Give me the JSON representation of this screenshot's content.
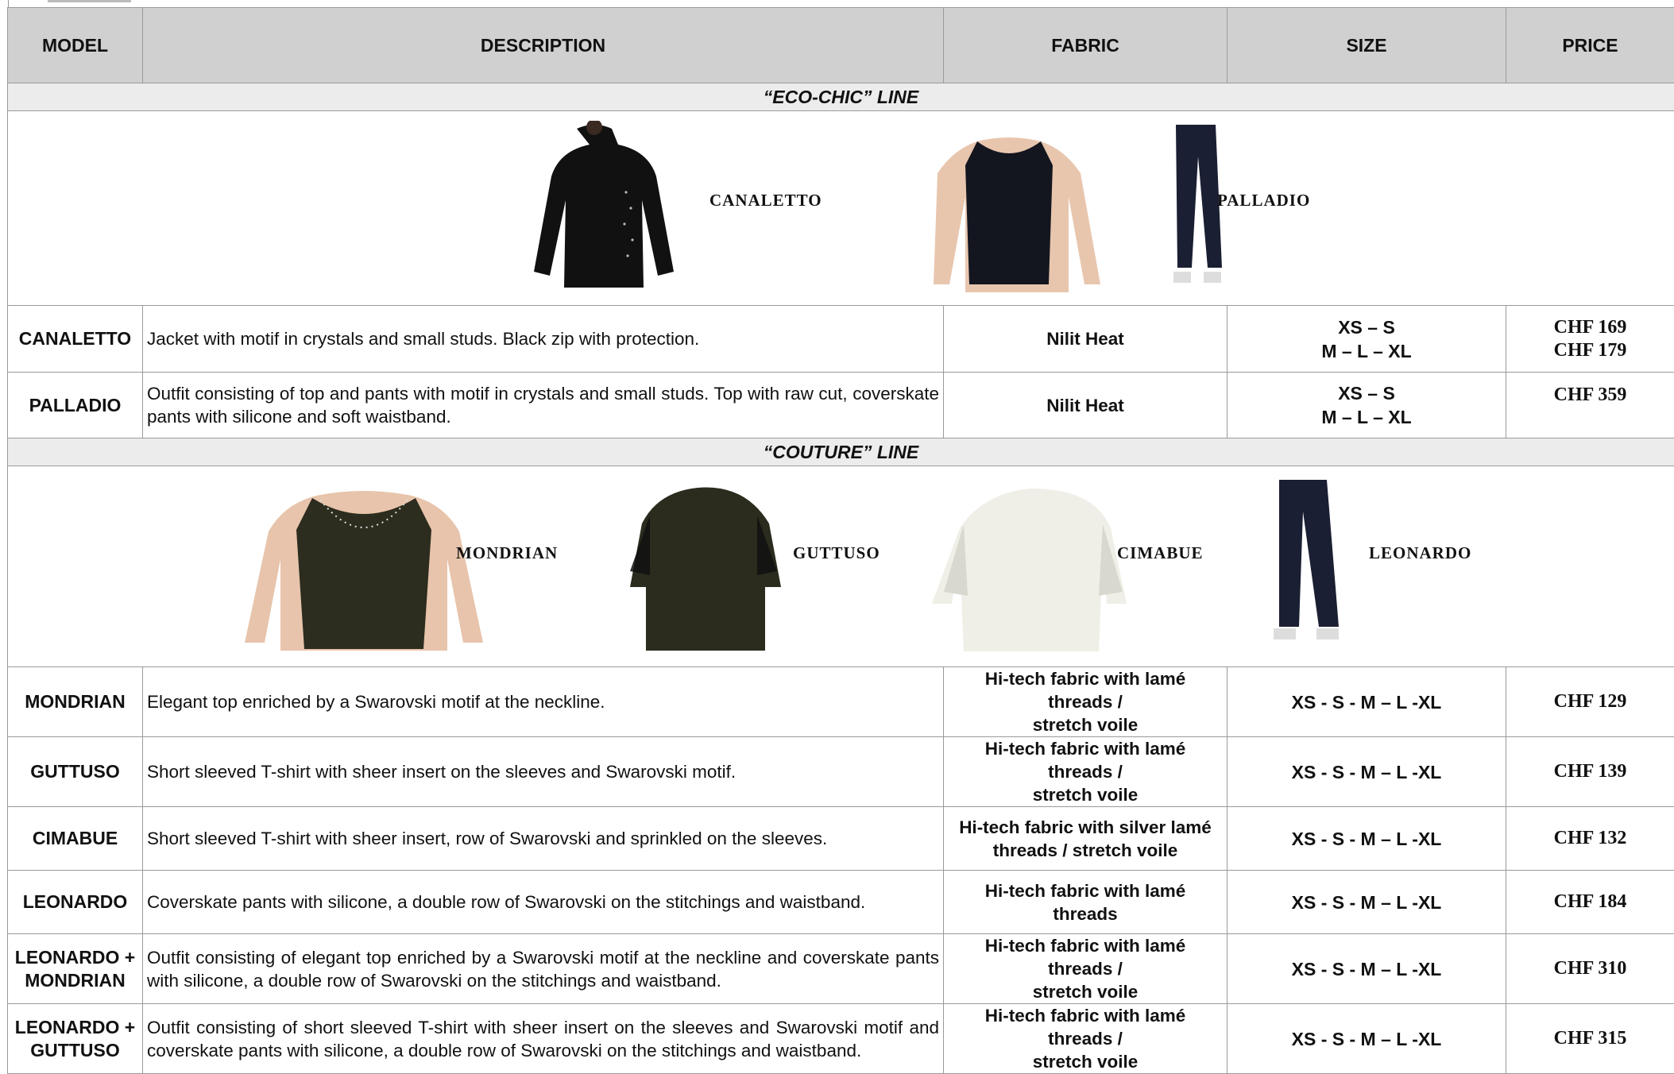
{
  "headers": {
    "model": "MODEL",
    "description": "DESCRIPTION",
    "fabric": "FABRIC",
    "size": "SIZE",
    "price": "PRICE"
  },
  "eco_chic": {
    "title": "“ECO-CHIC” LINE",
    "gallery": [
      "CANALETTO",
      "PALLADIO"
    ],
    "rows": [
      {
        "model": "CANALETTO",
        "description": "Jacket with motif in crystals and small studs. Black zip with protection.",
        "fabric": "Nilit Heat",
        "size_1": "XS – S",
        "size_2": "M – L – XL",
        "price_1": "CHF 169",
        "price_2": "CHF 179"
      },
      {
        "model": "PALLADIO",
        "description": "Outfit consisting of top and pants with motif in crystals and small studs. Top with raw cut, coverskate pants with silicone and soft waistband.",
        "fabric": "Nilit Heat",
        "size_1": "XS – S",
        "size_2": "M – L – XL",
        "price_1": "CHF 359"
      }
    ]
  },
  "couture": {
    "title": "“COUTURE” LINE",
    "gallery": [
      "MONDRIAN",
      "GUTTUSO",
      "CIMABUE",
      "LEONARDO"
    ],
    "rows": [
      {
        "model_1": "MONDRIAN",
        "description": "Elegant top enriched by a Swarovski motif at the neckline.",
        "fabric_1": "Hi-tech fabric with lamé threads /",
        "fabric_2": "stretch voile",
        "size": "XS - S - M – L -XL",
        "price": "CHF 129"
      },
      {
        "model_1": "GUTTUSO",
        "description": "Short sleeved T-shirt with sheer insert on the sleeves and Swarovski motif.",
        "fabric_1": "Hi-tech fabric with lamé threads /",
        "fabric_2": "stretch voile",
        "size": "XS - S - M – L -XL",
        "price": "CHF 139"
      },
      {
        "model_1": "CIMABUE",
        "description": "Short sleeved T-shirt with sheer insert, row of Swarovski and sprinkled on the sleeves.",
        "fabric_1": "Hi-tech fabric with silver lamé",
        "fabric_2": "threads / stretch voile",
        "size": "XS - S - M – L -XL",
        "price": "CHF 132"
      },
      {
        "model_1": "LEONARDO",
        "description": "Coverskate pants with silicone, a double row of Swarovski on the stitchings and waistband.",
        "fabric_1": "Hi-tech fabric with lamé threads",
        "size": "XS - S - M – L -XL",
        "price": "CHF 184"
      },
      {
        "model_1": "LEONARDO +",
        "model_2": "MONDRIAN",
        "description": "Outfit consisting of elegant top enriched by a Swarovski motif at the neckline and coverskate pants with silicone, a double row of Swarovski on the stitchings and waistband.",
        "fabric_1": "Hi-tech fabric with lamé threads /",
        "fabric_2": "stretch voile",
        "size": "XS - S - M – L -XL",
        "price": "CHF 310"
      },
      {
        "model_1": "LEONARDO +",
        "model_2": "GUTTUSO",
        "description": "Outfit consisting of short sleeved T-shirt with sheer insert on the sleeves and Swarovski motif  and coverskate pants with silicone, a double row of Swarovski on the stitchings and waistband.",
        "fabric_1": "Hi-tech fabric with lamé threads /",
        "fabric_2": "stretch voile",
        "size": "XS - S - M – L -XL",
        "price": "CHF 315"
      }
    ]
  }
}
